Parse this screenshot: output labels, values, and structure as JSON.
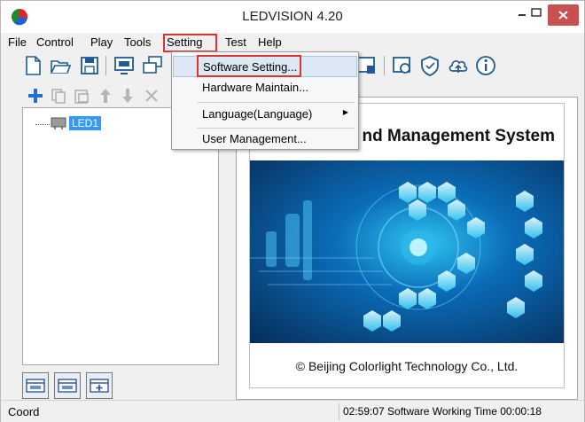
{
  "window": {
    "title": "LEDVISION 4.20"
  },
  "menubar": {
    "items": [
      "File",
      "Control",
      "Play",
      "Tools",
      "Setting",
      "Test",
      "Help"
    ]
  },
  "dropdown": {
    "items": [
      {
        "label": "Software Setting...",
        "submenu": false,
        "highlighted": true
      },
      {
        "label": "Hardware Maintain...",
        "submenu": false
      },
      {
        "label": "Language(Language)",
        "submenu": true
      },
      {
        "label": "User Management...",
        "submenu": false
      }
    ]
  },
  "tree": {
    "items": [
      {
        "label": "LED1",
        "icon": "screen-icon",
        "selected": true
      }
    ]
  },
  "splash": {
    "title": "nd Management System",
    "copyright": "© Beijing Colorlight Technology Co., Ltd."
  },
  "statusbar": {
    "left": "Coord",
    "right": "02:59:07 Software Working Time 00:00:18"
  },
  "toolbar": {
    "icons": [
      "new-file-icon",
      "open-folder-icon",
      "save-icon",
      "display-icon",
      "window-icon",
      "lock-screen-icon",
      "settings-screen-icon",
      "shield-icon",
      "cloud-upload-icon",
      "info-icon"
    ]
  },
  "left_toolbar": {
    "icons": [
      "add-icon",
      "copy-icon",
      "paste-icon",
      "move-up-icon",
      "move-down-icon",
      "delete-icon"
    ]
  },
  "colors": {
    "accent_red": "#e0302f",
    "selection_blue": "#3399ff",
    "splash_blue": "#0a4f8f"
  }
}
